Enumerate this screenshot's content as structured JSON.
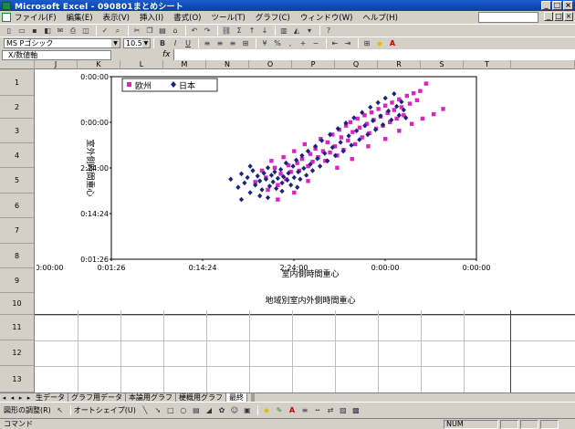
{
  "window": {
    "title": "Microsoft Excel - 090801まとめシート"
  },
  "menu": {
    "items": [
      "ファイル(F)",
      "編集(E)",
      "表示(V)",
      "挿入(I)",
      "書式(O)",
      "ツール(T)",
      "グラフ(C)",
      "ウィンドウ(W)",
      "ヘルプ(H)"
    ]
  },
  "toolbar": {
    "font_name": "MS Pゴシック",
    "font_size": "10.5",
    "bold": "B",
    "italic": "I",
    "underline": "U",
    "percent": "%"
  },
  "formula": {
    "name_box": "X/数値軸",
    "fx": "fx"
  },
  "columns": [
    "J",
    "K",
    "L",
    "M",
    "N",
    "O",
    "P",
    "Q",
    "R",
    "S",
    "T"
  ],
  "rows": [
    "1",
    "2",
    "3",
    "4",
    "5",
    "6",
    "7",
    "8",
    "9",
    "10",
    "11",
    "12",
    "13"
  ],
  "chart_data": {
    "type": "scatter",
    "ylabel": "室外側時間重心",
    "xlabel": "室内側時間重心",
    "caption": "地域別室内外側時間重心",
    "y_tick_labels": [
      "0:00:00",
      "0:00:00",
      "2:24:00",
      "0:14:24",
      "0:01:26"
    ],
    "x_tick_labels": [
      "0:00:00",
      "0:01:26",
      "0:14:24",
      "2:24:00",
      "0:00:00",
      "0:00:00"
    ],
    "legend_position": "top-left",
    "log_scale": true,
    "xlim": [
      1,
      2000
    ],
    "ylim": [
      1,
      2000
    ],
    "series": [
      {
        "name": "欧州",
        "color": "#e020c8",
        "marker": "square",
        "points": [
          [
            20,
            25
          ],
          [
            23,
            40
          ],
          [
            25,
            30
          ],
          [
            26,
            18
          ],
          [
            28,
            60
          ],
          [
            30,
            45
          ],
          [
            32,
            22
          ],
          [
            34,
            35
          ],
          [
            36,
            70
          ],
          [
            38,
            28
          ],
          [
            40,
            50
          ],
          [
            42,
            38
          ],
          [
            45,
            90
          ],
          [
            48,
            55
          ],
          [
            50,
            40
          ],
          [
            53,
            65
          ],
          [
            56,
            120
          ],
          [
            60,
            48
          ],
          [
            63,
            80
          ],
          [
            66,
            58
          ],
          [
            70,
            100
          ],
          [
            74,
            70
          ],
          [
            78,
            150
          ],
          [
            82,
            90
          ],
          [
            86,
            60
          ],
          [
            90,
            130
          ],
          [
            95,
            85
          ],
          [
            100,
            180
          ],
          [
            105,
            110
          ],
          [
            110,
            75
          ],
          [
            115,
            220
          ],
          [
            120,
            160
          ],
          [
            126,
            95
          ],
          [
            132,
            260
          ],
          [
            138,
            140
          ],
          [
            145,
            300
          ],
          [
            152,
            200
          ],
          [
            160,
            120
          ],
          [
            168,
            350
          ],
          [
            176,
            240
          ],
          [
            185,
            160
          ],
          [
            195,
            400
          ],
          [
            205,
            280
          ],
          [
            215,
            190
          ],
          [
            225,
            450
          ],
          [
            236,
            330
          ],
          [
            248,
            230
          ],
          [
            260,
            520
          ],
          [
            272,
            380
          ],
          [
            285,
            260
          ],
          [
            300,
            600
          ],
          [
            315,
            440
          ],
          [
            330,
            300
          ],
          [
            345,
            680
          ],
          [
            360,
            500
          ],
          [
            380,
            350
          ],
          [
            400,
            780
          ],
          [
            420,
            560
          ],
          [
            440,
            400
          ],
          [
            470,
            900
          ],
          [
            500,
            650
          ],
          [
            540,
            1000
          ],
          [
            580,
            750
          ],
          [
            620,
            1100
          ],
          [
            700,
            1500
          ],
          [
            32,
            12
          ],
          [
            45,
            16
          ],
          [
            60,
            26
          ],
          [
            110,
            45
          ],
          [
            150,
            65
          ],
          [
            210,
            110
          ],
          [
            300,
            150
          ],
          [
            400,
            210
          ],
          [
            520,
            280
          ],
          [
            650,
            350
          ],
          [
            820,
            420
          ],
          [
            1000,
            520
          ]
        ]
      },
      {
        "name": "日本",
        "color": "#1a237e",
        "marker": "diamond",
        "points": [
          [
            12,
            28
          ],
          [
            14,
            20
          ],
          [
            15,
            35
          ],
          [
            16,
            24
          ],
          [
            17,
            30
          ],
          [
            18,
            16
          ],
          [
            19,
            40
          ],
          [
            20,
            22
          ],
          [
            21,
            32
          ],
          [
            22,
            26
          ],
          [
            23,
            18
          ],
          [
            24,
            36
          ],
          [
            25,
            28
          ],
          [
            26,
            45
          ],
          [
            27,
            21
          ],
          [
            28,
            33
          ],
          [
            29,
            25
          ],
          [
            30,
            38
          ],
          [
            31,
            19
          ],
          [
            32,
            29
          ],
          [
            34,
            42
          ],
          [
            35,
            24
          ],
          [
            36,
            31
          ],
          [
            38,
            55
          ],
          [
            39,
            27
          ],
          [
            40,
            36
          ],
          [
            42,
            22
          ],
          [
            44,
            48
          ],
          [
            45,
            30
          ],
          [
            47,
            62
          ],
          [
            49,
            38
          ],
          [
            51,
            28
          ],
          [
            53,
            75
          ],
          [
            55,
            44
          ],
          [
            58,
            33
          ],
          [
            60,
            90
          ],
          [
            63,
            52
          ],
          [
            66,
            40
          ],
          [
            70,
            110
          ],
          [
            73,
            66
          ],
          [
            77,
            48
          ],
          [
            80,
            140
          ],
          [
            85,
            82
          ],
          [
            90,
            60
          ],
          [
            95,
            180
          ],
          [
            100,
            105
          ],
          [
            106,
            75
          ],
          [
            112,
            230
          ],
          [
            118,
            130
          ],
          [
            125,
            90
          ],
          [
            132,
            290
          ],
          [
            140,
            170
          ],
          [
            148,
            115
          ],
          [
            156,
            360
          ],
          [
            165,
            210
          ],
          [
            175,
            145
          ],
          [
            185,
            450
          ],
          [
            196,
            260
          ],
          [
            208,
            180
          ],
          [
            220,
            560
          ],
          [
            232,
            320
          ],
          [
            245,
            220
          ],
          [
            258,
            680
          ],
          [
            272,
            390
          ],
          [
            286,
            270
          ],
          [
            300,
            820
          ],
          [
            320,
            480
          ],
          [
            340,
            330
          ],
          [
            360,
            980
          ],
          [
            380,
            580
          ],
          [
            400,
            400
          ],
          [
            420,
            700
          ],
          [
            440,
            500
          ],
          [
            460,
            360
          ],
          [
            15,
            12
          ],
          [
            22,
            14
          ],
          [
            26,
            13
          ],
          [
            35,
            17
          ],
          [
            48,
            20
          ],
          [
            18,
            48
          ]
        ]
      }
    ]
  },
  "sheet_tabs": [
    "生データ",
    "グラフ用データ",
    "本論用グラフ",
    "梗概用グラフ",
    "最終"
  ],
  "active_tab": "最終",
  "drawbar": {
    "draw_label": "図形の調整(R)",
    "autoshape_label": "オートシェイプ(U)"
  },
  "status": {
    "mode": "コマンド",
    "num": "NUM"
  }
}
